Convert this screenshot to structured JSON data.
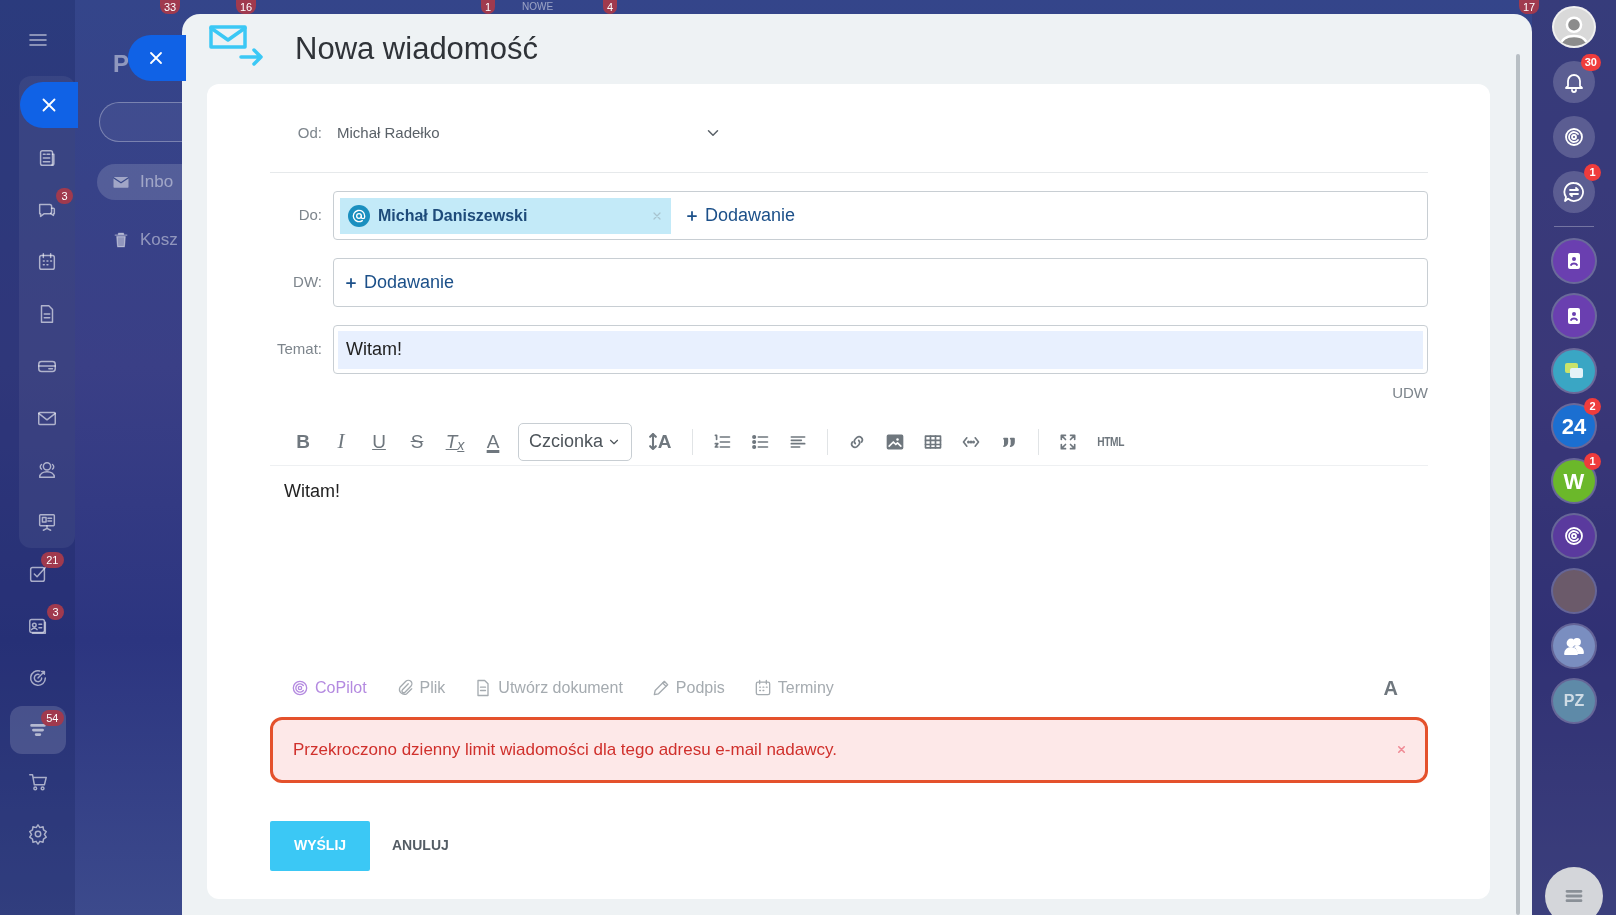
{
  "background_badges": [
    {
      "label": "33"
    },
    {
      "label": "16"
    },
    {
      "label": "1"
    },
    {
      "label": "NOWE",
      "kind": "text"
    },
    {
      "label": "4"
    },
    {
      "label": "17"
    }
  ],
  "left_sidebar": {
    "buttons": [
      {
        "kind": "menu"
      },
      {
        "kind": "close"
      }
    ],
    "items": [
      {
        "kind": "feed",
        "selected": false
      },
      {
        "kind": "chat",
        "badge": "3",
        "selected": false
      },
      {
        "kind": "calendar",
        "selected": false
      },
      {
        "kind": "document",
        "selected": false
      },
      {
        "kind": "drive",
        "selected": false
      },
      {
        "kind": "mail",
        "selected": false
      },
      {
        "kind": "people",
        "selected": false
      },
      {
        "kind": "board",
        "selected": false
      },
      {
        "kind": "tasks",
        "badge": "21",
        "selected": false
      },
      {
        "kind": "contact-card",
        "badge": "3",
        "selected": false
      },
      {
        "kind": "target",
        "selected": false
      },
      {
        "kind": "funnel",
        "badge": "54",
        "selected": true
      },
      {
        "kind": "cart",
        "selected": false
      },
      {
        "kind": "gear",
        "selected": false
      }
    ]
  },
  "background_page": {
    "title": "P",
    "folders": [
      {
        "kind": "inbox",
        "label": "Inbo",
        "selected": true
      },
      {
        "kind": "trash",
        "label": "Kosz",
        "selected": false
      }
    ]
  },
  "compose": {
    "title": "Nowa wiadomość",
    "from": {
      "label": "Od:",
      "value": "Michał Radełko"
    },
    "to": {
      "label": "Do:",
      "recipients": [
        {
          "name": "Michał Daniszewski"
        }
      ],
      "add": "Dodawanie"
    },
    "cc": {
      "label": "DW:",
      "add": "Dodawanie"
    },
    "subject": {
      "label": "Temat:",
      "value": "Witam!"
    },
    "bcc_link": "UDW",
    "toolbar": [
      [
        {
          "kind": "bold",
          "label": "B"
        },
        {
          "kind": "italic",
          "label": "I"
        },
        {
          "kind": "underline",
          "label": "U"
        },
        {
          "kind": "strike",
          "label": "S"
        },
        {
          "kind": "clear",
          "label": "T$_{x}$"
        },
        {
          "kind": "color",
          "label": "A"
        },
        {
          "kind": "font",
          "label": "Czcionka"
        },
        {
          "kind": "size",
          "label": "A"
        }
      ],
      [
        {
          "kind": "ordered-list"
        },
        {
          "kind": "bullet-list"
        },
        {
          "kind": "align"
        }
      ],
      [
        {
          "kind": "link"
        },
        {
          "kind": "image"
        },
        {
          "kind": "table"
        },
        {
          "kind": "code"
        },
        {
          "kind": "quote"
        }
      ],
      [
        {
          "kind": "fullscreen"
        },
        {
          "kind": "html",
          "label": "HTML"
        }
      ]
    ],
    "body": "Witam!",
    "actions": [
      {
        "kind": "copilot",
        "label": "CoPilot"
      },
      {
        "kind": "clip",
        "label": "Plik"
      },
      {
        "kind": "doc",
        "label": "Utwórz dokument"
      },
      {
        "kind": "pen",
        "label": "Podpis"
      },
      {
        "kind": "calendar",
        "label": "Terminy"
      }
    ],
    "format_toggle": "A",
    "error": {
      "message": "Przekroczono dzienny limit wiadomości dla tego adresu e-mail nadawcy."
    },
    "send": "WYŚLIJ",
    "cancel": "ANULUJ"
  },
  "right_sidebar": {
    "top": [
      {
        "kind": "avatar"
      },
      {
        "kind": "bell",
        "badge": "30"
      },
      {
        "kind": "copilot"
      },
      {
        "kind": "chat-swap",
        "badge": "1"
      }
    ],
    "apps": [
      {
        "kind": "contact-book",
        "color": "#6a3fb0"
      },
      {
        "kind": "contact-book",
        "color": "#6a3fb0"
      },
      {
        "kind": "chat-bubbles",
        "color": "#3aa6c4"
      },
      {
        "kind": "text",
        "label": "24",
        "color": "#1b6fd1",
        "badge": "2"
      },
      {
        "kind": "text",
        "label": "W",
        "color": "#6bb82a",
        "badge": "1"
      },
      {
        "kind": "copilot",
        "color": "#5a3a9e"
      },
      {
        "kind": "photo",
        "color": "#6b5a6a"
      },
      {
        "kind": "people",
        "color": "#7a8ec0"
      },
      {
        "kind": "text",
        "label": "PZ",
        "color": "#5e8aa8"
      }
    ]
  }
}
